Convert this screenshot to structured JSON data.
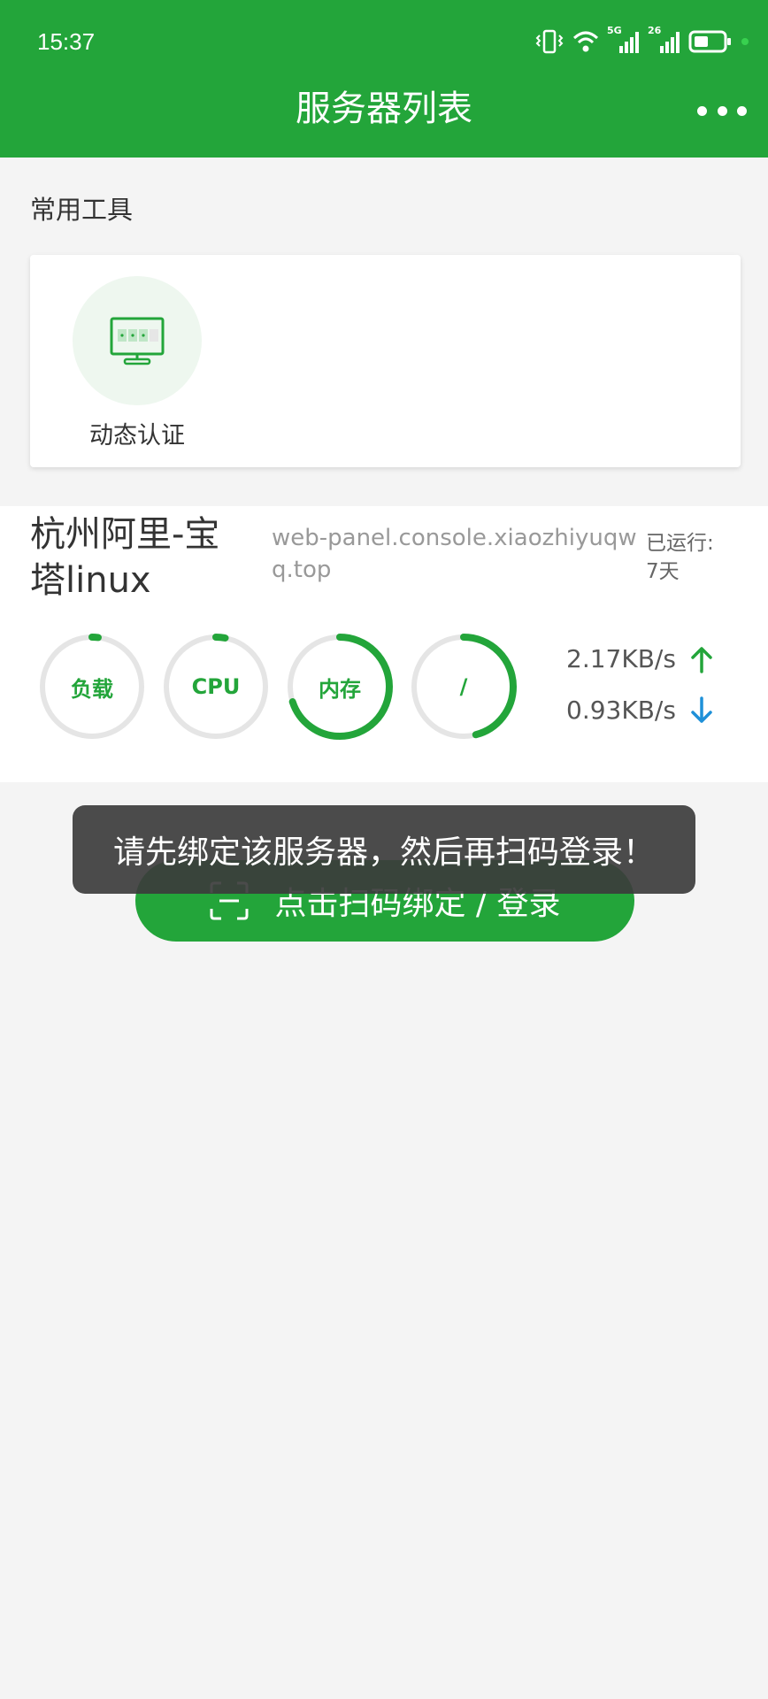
{
  "status_bar": {
    "time": "15:37",
    "signal_1_label": "5G",
    "signal_2_label": "26"
  },
  "header": {
    "title": "服务器列表"
  },
  "tools": {
    "section_title": "常用工具",
    "items": [
      {
        "label": "动态认证",
        "icon": "monitor-password-icon"
      }
    ]
  },
  "server": {
    "name": "杭州阿里-宝塔linux",
    "url": "web-panel.console.xiaozhiyuqwq.top",
    "uptime_label": "已运行:",
    "uptime_value": "7天",
    "gauges": [
      {
        "label": "负载",
        "percent": 2
      },
      {
        "label": "CPU",
        "percent": 3
      },
      {
        "label": "内存",
        "percent": 70
      },
      {
        "label": "/",
        "percent": 46
      }
    ],
    "upload_speed": "2.17KB/s",
    "download_speed": "0.93KB/s"
  },
  "bind_button": {
    "label": "点击扫码绑定 / 登录",
    "icon": "scan-icon"
  },
  "toast": {
    "message": "请先绑定该服务器，然后再扫码登录！"
  },
  "colors": {
    "brand": "#23a53a",
    "download_arrow": "#1e90d8",
    "gauge_track": "#e5e5e5"
  }
}
